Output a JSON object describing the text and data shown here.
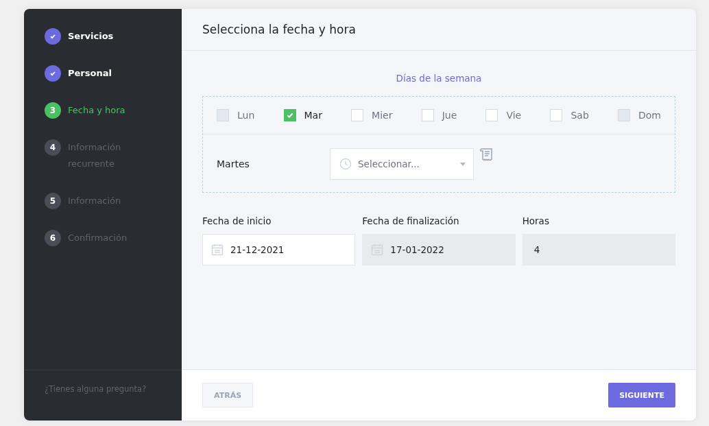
{
  "steps": [
    {
      "label": "Servicios",
      "completed": true,
      "selected": false
    },
    {
      "label": "Personal",
      "completed": true,
      "selected": false
    },
    {
      "number": "3",
      "label": "Fecha y hora",
      "completed": false,
      "selected": true
    },
    {
      "number": "4",
      "label": "Información recurrente",
      "completed": false,
      "selected": false
    },
    {
      "number": "5",
      "label": "Información",
      "completed": false,
      "selected": false
    },
    {
      "number": "6",
      "label": "Confirmación",
      "completed": false,
      "selected": false
    }
  ],
  "sidebar_footer": "¿Tienes alguna pregunta?",
  "title": "Selecciona la fecha y hora",
  "weekdays_heading": "Días de la semana",
  "weekdays": [
    {
      "label": "Lun",
      "checked": false,
      "disabled": true
    },
    {
      "label": "Mar",
      "checked": true,
      "disabled": false
    },
    {
      "label": "Mier",
      "checked": false,
      "disabled": false
    },
    {
      "label": "Jue",
      "checked": false,
      "disabled": false
    },
    {
      "label": "Vie",
      "checked": false,
      "disabled": false
    },
    {
      "label": "Sab",
      "checked": false,
      "disabled": false
    },
    {
      "label": "Dom",
      "checked": false,
      "disabled": true
    }
  ],
  "day_rows": [
    {
      "day": "Martes",
      "placeholder": "Seleccionar..."
    }
  ],
  "fields": [
    {
      "label": "Fecha de inicio",
      "value": "21-12-2021",
      "kind": "date",
      "disabled": false
    },
    {
      "label": "Fecha de finalización",
      "value": "17-01-2022",
      "kind": "date",
      "disabled": true
    },
    {
      "label": "Horas",
      "value": "4",
      "kind": "text",
      "disabled": true
    }
  ],
  "buttons": {
    "back": "ATRÁS",
    "next": "SIGUIENTE"
  }
}
